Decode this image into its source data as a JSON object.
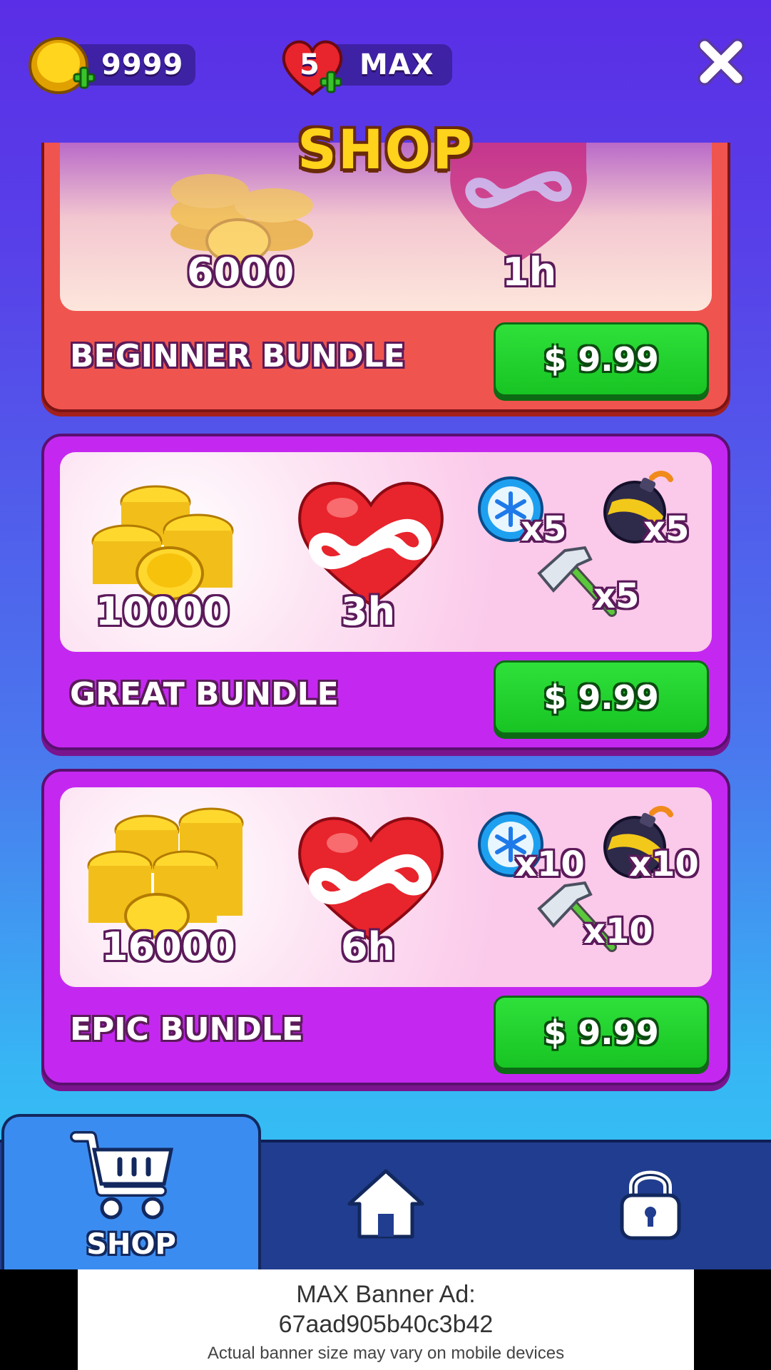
{
  "top_bar": {
    "coins": "9999",
    "lives": "5",
    "lives_status": "MAX"
  },
  "title": "SHOP",
  "bundles": [
    {
      "name": "BEGINNER BUNDLE",
      "price": "$ 9.99",
      "coins": "6000",
      "infinite_lives": "1h",
      "theme": "red"
    },
    {
      "name": "GREAT BUNDLE",
      "price": "$ 9.99",
      "coins": "10000",
      "infinite_lives": "3h",
      "freeze": "x5",
      "bomb": "x5",
      "hammer": "x5",
      "theme": "purple"
    },
    {
      "name": "EPIC BUNDLE",
      "price": "$ 9.99",
      "coins": "16000",
      "infinite_lives": "6h",
      "freeze": "x10",
      "bomb": "x10",
      "hammer": "x10",
      "theme": "purple"
    }
  ],
  "nav": {
    "shop_label": "SHOP",
    "active": "shop",
    "items": [
      "cart-icon",
      "home-icon",
      "lock-icon"
    ]
  },
  "ad": {
    "line1": "MAX Banner Ad:",
    "line2": "67aad905b40c3b42",
    "line3": "Actual banner size may vary on mobile devices"
  },
  "colors": {
    "red_card": "#f0544f",
    "purple_card": "#c428f0",
    "buy_button": "#1dd02a",
    "title": "#ffd21c"
  }
}
